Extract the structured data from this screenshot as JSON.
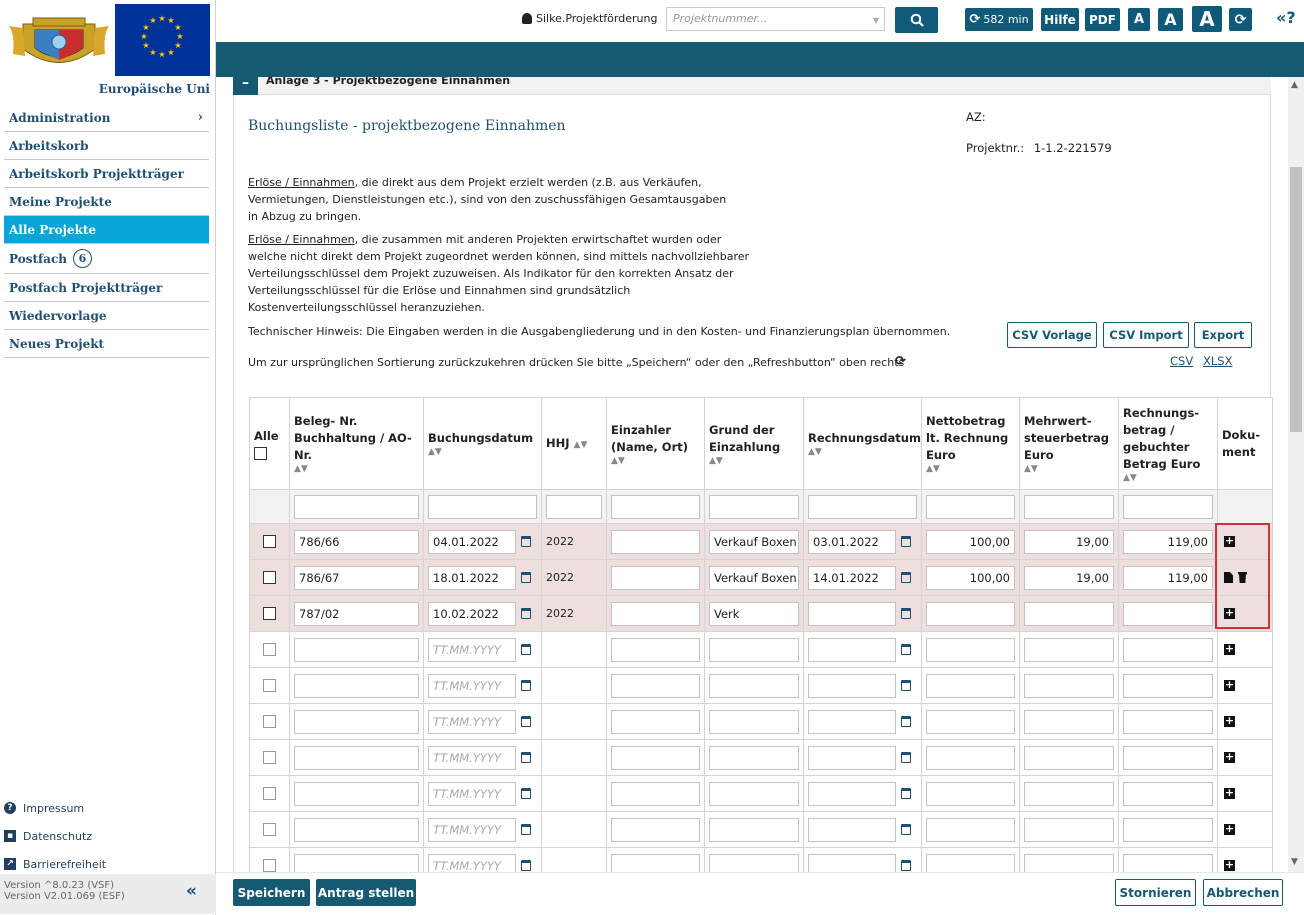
{
  "sidebar": {
    "logo_text": "Europäische Uni",
    "nav": [
      {
        "label": "Administration",
        "has_chevron": true,
        "active": false
      },
      {
        "label": "Arbeitskorb",
        "active": false
      },
      {
        "label": "Arbeitskorb Projektträger",
        "active": false
      },
      {
        "label": "Meine Projekte",
        "active": false
      },
      {
        "label": "Alle Projekte",
        "active": true
      },
      {
        "label": "Postfach",
        "badge": "6",
        "active": false
      },
      {
        "label": "Postfach Projektträger",
        "active": false
      },
      {
        "label": "Wiedervorlage",
        "active": false
      },
      {
        "label": "Neues Projekt",
        "active": false
      }
    ],
    "footer_links": [
      {
        "label": "Impressum",
        "icon": "help-icon"
      },
      {
        "label": "Datenschutz",
        "icon": "id-card-icon"
      },
      {
        "label": "Barrierefreiheit",
        "icon": "accessibility-icon"
      }
    ],
    "version_lines": [
      "Version ^8.0.23 (VSF)",
      "Version V2.01.069 (ESF)"
    ],
    "collapse_glyph": "«"
  },
  "topbar": {
    "user": "Silke.Projektförderung",
    "project_placeholder": "Projektnummer...",
    "timer": "582 min",
    "help": "Hilfe",
    "pdf": "PDF",
    "font_small": "A",
    "font_medium": "A",
    "font_large": "A",
    "info": "«?"
  },
  "section": {
    "title": "Anlage 3 - Projektbezogene Einnahmen"
  },
  "page": {
    "title": "Buchungsliste - projektbezogene Einnahmen",
    "az_label": "AZ:",
    "projnr_label": "Projektnr.:",
    "projnr_value": "1-1.2-221579",
    "p1_link": "Erlöse / Einnahmen",
    "p1_text": ", die direkt aus dem Projekt erzielt werden (z.B. aus Verkäufen, Vermietungen, Dienstleistungen etc.), sind von den zuschussfähigen Gesamtausgaben in Abzug zu bringen.",
    "p2_link": "Erlöse / Einnahmen",
    "p2_text": ", die zusammen mit anderen Projekten erwirtschaftet wurden oder welche nicht direkt dem Projekt zugeordnet werden können, sind mittels nachvollziehbarer Verteilungsschlüssel dem Projekt zuzuweisen. Als Indikator für den korrekten Ansatz der Verteilungsschlüssel für die Erlöse und Einnahmen sind grundsätzlich Kostenverteilungsschlüssel heranzuziehen.",
    "hint": "Technischer Hinweis: Die Eingaben werden in die Ausgabengliederung und in den Kosten- und Finanzierungsplan übernommen.",
    "sort_hint": "Um zur ursprünglichen Sortierung zurückzukehren drücken Sie bitte „Speichern“ oder den „Refreshbutton“ oben rechts",
    "btn_csv_template": "CSV Vorlage",
    "btn_csv_import": "CSV Import",
    "btn_export": "Export",
    "link_csv": "CSV",
    "link_xlsx": "XLSX"
  },
  "table": {
    "headers": {
      "all": "Alle",
      "beleg": "Beleg- Nr. Buchhaltung / AO-Nr.",
      "buchungsdatum": "Buchungsdatum",
      "hhj": "HHJ",
      "einzahler": "Einzahler (Name, Ort)",
      "grund": "Grund der Einzahlung",
      "rechnungsdatum": "Rechnungsdatum",
      "netto": "Nettobetrag lt. Rechnung Euro",
      "mwst": "Mehrwert-steuerbetrag Euro",
      "brutto": "Rechnungs-betrag / gebuchter Betrag Euro",
      "dokument": "Doku-ment"
    },
    "date_placeholder": "TT.MM.YYYY",
    "rows": [
      {
        "beleg": "786/66",
        "buchungsdatum": "04.01.2022",
        "hhj": "2022",
        "einzahler": "",
        "grund": "Verkauf Boxen",
        "rechnungsdatum": "03.01.2022",
        "netto": "100,00",
        "mwst": "19,00",
        "brutto": "119,00",
        "doc": "add"
      },
      {
        "beleg": "786/67",
        "buchungsdatum": "18.01.2022",
        "hhj": "2022",
        "einzahler": "",
        "grund": "Verkauf Boxen",
        "rechnungsdatum": "14.01.2022",
        "netto": "100,00",
        "mwst": "19,00",
        "brutto": "119,00",
        "doc": "file"
      },
      {
        "beleg": "787/02",
        "buchungsdatum": "10.02.2022",
        "hhj": "2022",
        "einzahler": "",
        "grund": "Verk",
        "rechnungsdatum": "",
        "netto": "",
        "mwst": "",
        "brutto": "",
        "doc": "add"
      }
    ],
    "empty_rows": 7
  },
  "bottom": {
    "save": "Speichern",
    "submit": "Antrag stellen",
    "cancel": "Stornieren",
    "abort": "Abbrechen"
  }
}
